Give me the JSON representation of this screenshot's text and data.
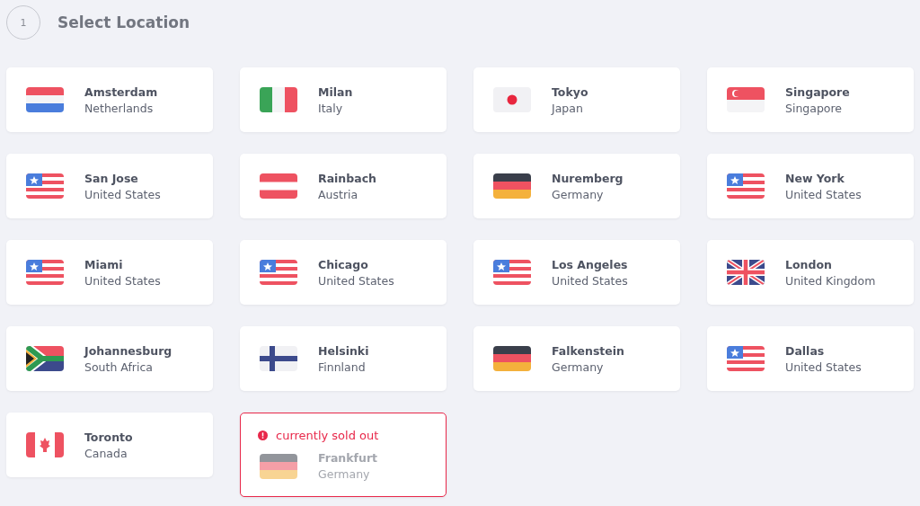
{
  "step": {
    "number": "1",
    "title": "Select Location"
  },
  "locations": [
    {
      "city": "Amsterdam",
      "country": "Netherlands",
      "kind": "nl",
      "sold_out": false
    },
    {
      "city": "Milan",
      "country": "Italy",
      "kind": "it",
      "sold_out": false
    },
    {
      "city": "Tokyo",
      "country": "Japan",
      "kind": "jp",
      "sold_out": false
    },
    {
      "city": "Singapore",
      "country": "Singapore",
      "kind": "sg",
      "sold_out": false
    },
    {
      "city": "San Jose",
      "country": "United States",
      "kind": "us",
      "sold_out": false
    },
    {
      "city": "Rainbach",
      "country": "Austria",
      "kind": "at",
      "sold_out": false
    },
    {
      "city": "Nuremberg",
      "country": "Germany",
      "kind": "de",
      "sold_out": false
    },
    {
      "city": "New York",
      "country": "United States",
      "kind": "us",
      "sold_out": false
    },
    {
      "city": "Miami",
      "country": "United States",
      "kind": "us",
      "sold_out": false
    },
    {
      "city": "Chicago",
      "country": "United States",
      "kind": "us",
      "sold_out": false
    },
    {
      "city": "Los Angeles",
      "country": "United States",
      "kind": "us",
      "sold_out": false
    },
    {
      "city": "London",
      "country": "United Kingdom",
      "kind": "gb",
      "sold_out": false
    },
    {
      "city": "Johannesburg",
      "country": "South Africa",
      "kind": "za",
      "sold_out": false
    },
    {
      "city": "Helsinki",
      "country": "Finnland",
      "kind": "fi",
      "sold_out": false
    },
    {
      "city": "Falkenstein",
      "country": "Germany",
      "kind": "de",
      "sold_out": false
    },
    {
      "city": "Dallas",
      "country": "United States",
      "kind": "us",
      "sold_out": false
    },
    {
      "city": "Toronto",
      "country": "Canada",
      "kind": "ca",
      "sold_out": false
    },
    {
      "city": "Frankfurt",
      "country": "Germany",
      "kind": "de",
      "sold_out": true,
      "notice": "currently sold out"
    }
  ]
}
